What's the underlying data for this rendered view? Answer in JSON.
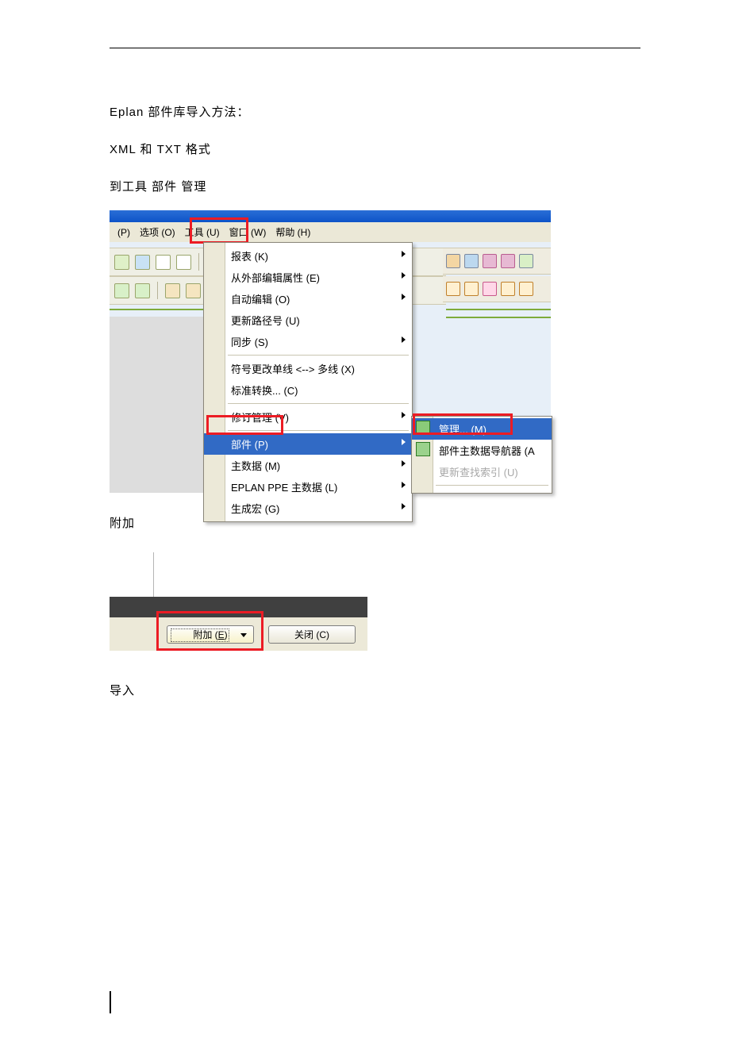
{
  "doc": {
    "p1": "Eplan 部件库导入方法：",
    "p2": "XML 和 TXT 格式",
    "p3": "到工具  部件  管理",
    "p4": "附加",
    "p5": "导入"
  },
  "menubar": {
    "m1": "(P)",
    "m2": "选项 (O)",
    "m3": "工具 (U)",
    "m4": "窗口 (W)",
    "m5": "帮助 (H)"
  },
  "menu": {
    "i1": "报表 (K)",
    "i2": "从外部编辑属性 (E)",
    "i3": "自动编辑 (O)",
    "i4": "更新路径号 (U)",
    "i5": "同步 (S)",
    "i6": "符号更改单线 <--> 多线 (X)",
    "i7": "标准转换... (C)",
    "i8": "修订管理 (V)",
    "i9": "部件 (P)",
    "i10": "主数据 (M)",
    "i11": "EPLAN PPE 主数据 (L)",
    "i12": "生成宏 (G)"
  },
  "submenu": {
    "s1": "管理... (M)",
    "s2": "部件主数据导航器 (A",
    "s3": "更新查找索引 (U)"
  },
  "dialog": {
    "btn_extra_a": "附加 (",
    "btn_extra_b": "E",
    "btn_extra_c": ")",
    "btn_close": "关闭 (C)"
  }
}
